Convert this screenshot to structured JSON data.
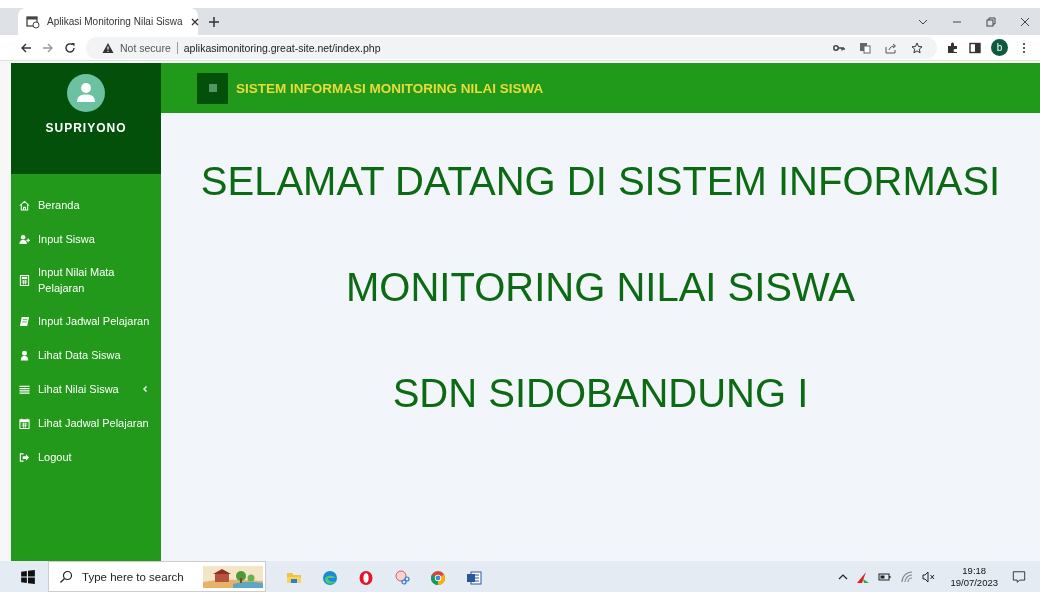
{
  "browser": {
    "tab_title": "Aplikasi Monitoring Nilai Siswa",
    "security": "Not secure",
    "url": "aplikasimonitoring.great-site.net/index.php",
    "profile": "b"
  },
  "sidebar": {
    "user": "SUPRIYONO",
    "items": [
      {
        "label": "Beranda",
        "kind": "link"
      },
      {
        "label": "Input Siswa",
        "kind": "link"
      },
      {
        "label": "Input Nilai Mata Pelajaran",
        "kind": "link"
      },
      {
        "label": "Input Jadwal Pelajaran",
        "kind": "link"
      },
      {
        "label": "Lihat Data Siswa",
        "kind": "link"
      },
      {
        "label": "Lihat Nilai Siswa",
        "kind": "submenu"
      },
      {
        "label": "Lihat Jadwal Pelajaran",
        "kind": "link"
      },
      {
        "label": "Logout",
        "kind": "link"
      }
    ]
  },
  "header": {
    "title": "SISTEM INFORMASI MONITORING NILAI SISWA"
  },
  "welcome": [
    "SELAMAT DATANG DI SISTEM INFORMASI",
    "MONITORING NILAI SISWA",
    "SDN SIDOBANDUNG I"
  ],
  "taskbar": {
    "search_placeholder": "Type here to search",
    "time": "19:18",
    "date": "19/07/2023"
  }
}
